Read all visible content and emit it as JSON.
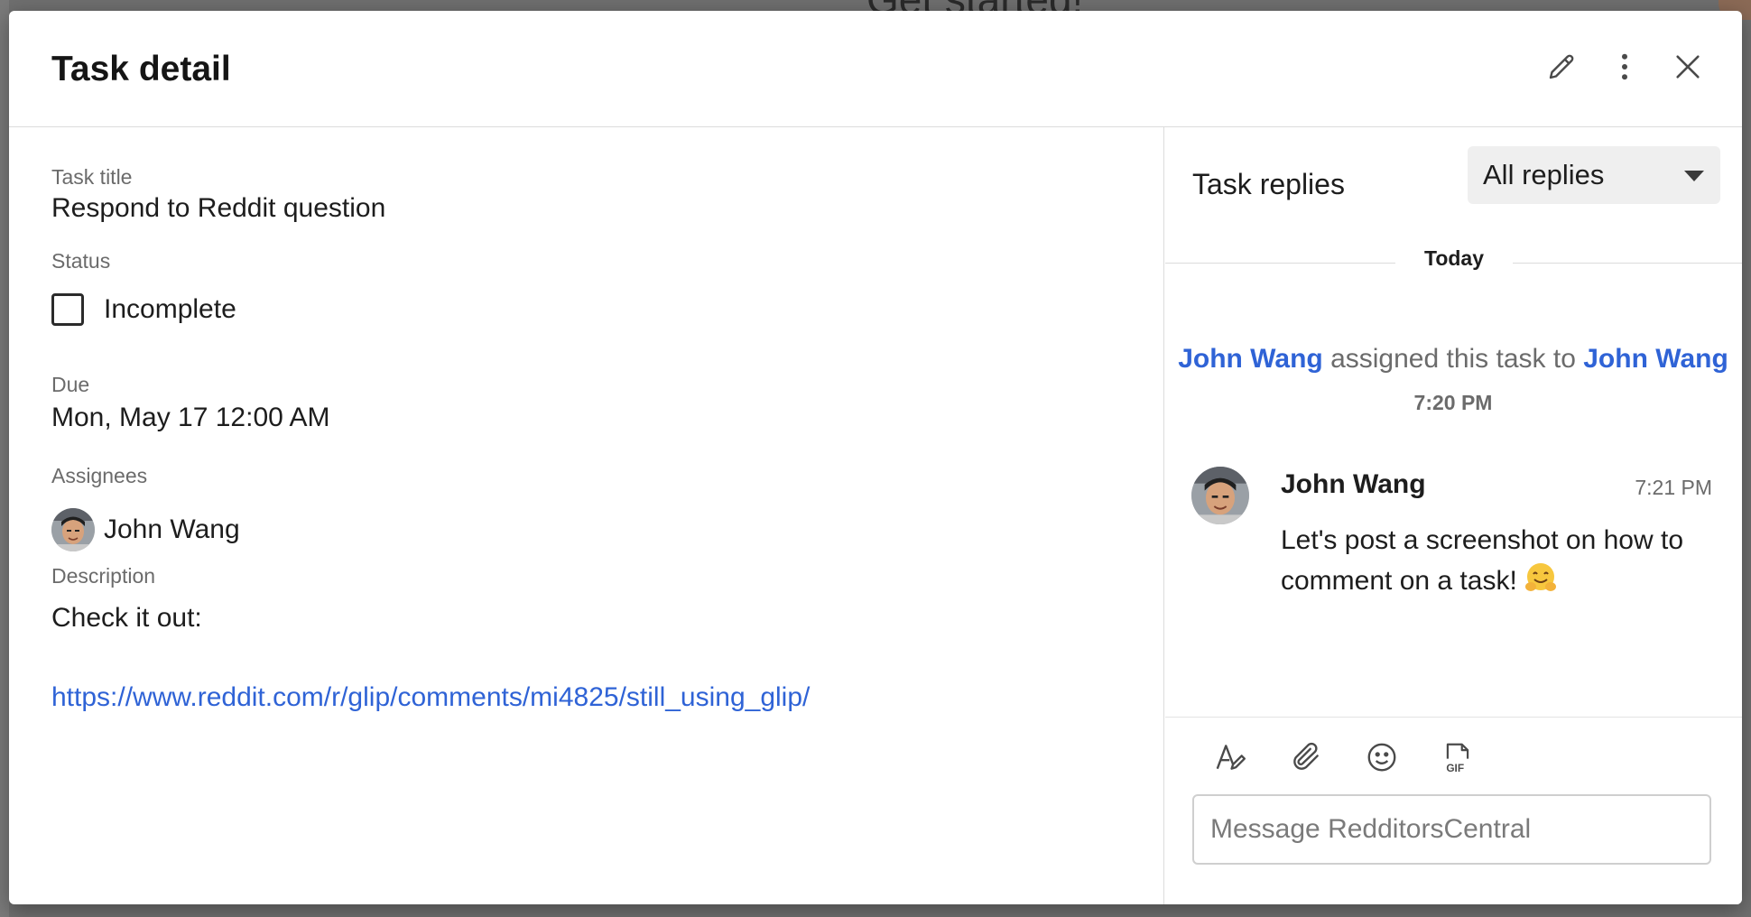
{
  "background": {
    "title": "Get started!"
  },
  "modal": {
    "title": "Task detail",
    "actions": {
      "edit_icon": "pencil-icon",
      "more_icon": "more-vertical-icon",
      "close_icon": "close-icon"
    }
  },
  "task": {
    "title_label": "Task title",
    "title_value": "Respond to Reddit question",
    "status_label": "Status",
    "status_value": "Incomplete",
    "due_label": "Due",
    "due_value": "Mon, May 17 12:00 AM",
    "assignees_label": "Assignees",
    "assignees": [
      {
        "name": "John Wang"
      }
    ],
    "description_label": "Description",
    "description_text": "Check it out:",
    "description_link": "https://www.reddit.com/r/glip/comments/mi4825/still_using_glip/"
  },
  "replies": {
    "title": "Task replies",
    "filter_value": "All replies",
    "date_divider": "Today",
    "system_event": {
      "actor": "John Wang",
      "action": "assigned this task to",
      "target": "John Wang",
      "time": "7:20 PM"
    },
    "posts": [
      {
        "author": "John Wang",
        "time": "7:21 PM",
        "text": "Let's post a screenshot on how to comment on a task!",
        "emoji": "hugging-face"
      }
    ]
  },
  "composer": {
    "placeholder": "Message RedditorsCentral",
    "tools": [
      "text-format-icon",
      "attachment-icon",
      "emoji-icon",
      "gif-icon"
    ]
  },
  "colors": {
    "link": "#2f63d6",
    "muted": "#6b6b6b",
    "text": "#1d1d1d"
  }
}
